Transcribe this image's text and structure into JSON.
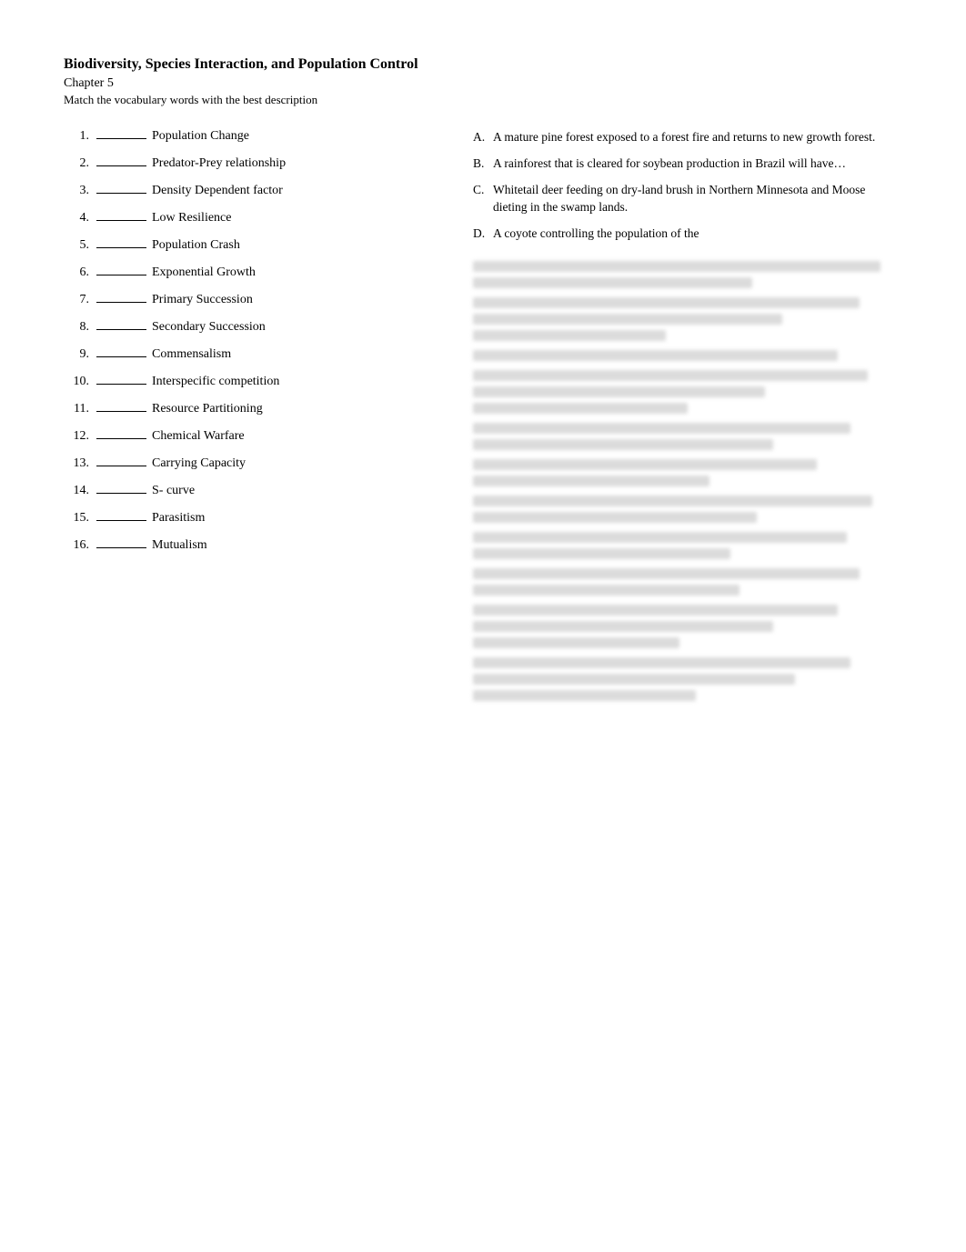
{
  "header": {
    "title": "Biodiversity, Species Interaction, and Population Control",
    "chapter": "Chapter 5",
    "instructions": "Match the vocabulary words with the best description"
  },
  "vocab_items": [
    {
      "number": "1.",
      "blank": "________",
      "term": "Population Change"
    },
    {
      "number": "2.",
      "blank": "________",
      "term": "Predator-Prey relationship"
    },
    {
      "number": "3.",
      "blank": "________",
      "term": "Density Dependent factor"
    },
    {
      "number": "4.",
      "blank": "________",
      "term": "Low Resilience"
    },
    {
      "number": "5.",
      "blank": "________",
      "term": "Population Crash"
    },
    {
      "number": "6.",
      "blank": "_______",
      "term": "Exponential Growth"
    },
    {
      "number": "7.",
      "blank": "________",
      "term": "Primary Succession"
    },
    {
      "number": "8.",
      "blank": "________",
      "term": "Secondary Succession"
    },
    {
      "number": "9.",
      "blank": "________",
      "term": "Commensalism"
    },
    {
      "number": "10.",
      "blank": "_______",
      "term": "Interspecific competition"
    },
    {
      "number": "11.",
      "blank": "________",
      "term": "Resource Partitioning"
    },
    {
      "number": "12.",
      "blank": "_______",
      "term": "Chemical Warfare"
    },
    {
      "number": "13.",
      "blank": "_______",
      "term": "Carrying Capacity"
    },
    {
      "number": "14.",
      "blank": "_______",
      "term": "S- curve"
    },
    {
      "number": "15.",
      "blank": "_______",
      "term": "Parasitism"
    },
    {
      "number": "16.",
      "blank": "",
      "term": "Mutualism"
    }
  ],
  "descriptions": [
    {
      "letter": "A.",
      "text": "A mature pine forest exposed to a forest fire and returns to new growth forest."
    },
    {
      "letter": "B.",
      "text": "A rainforest that is cleared for soybean production in Brazil will have…"
    },
    {
      "letter": "C.",
      "text": "Whitetail deer feeding on dry-land brush in Northern Minnesota and Moose dieting in the swamp lands."
    },
    {
      "letter": "D.",
      "text": "A coyote controlling the population of the"
    }
  ],
  "blurred_blocks": [
    {
      "lines": 2
    },
    {
      "lines": 2
    },
    {
      "lines": 1
    },
    {
      "lines": 2
    },
    {
      "lines": 2
    },
    {
      "lines": 2
    },
    {
      "lines": 2
    },
    {
      "lines": 2
    },
    {
      "lines": 2
    },
    {
      "lines": 2
    },
    {
      "lines": 2
    }
  ]
}
